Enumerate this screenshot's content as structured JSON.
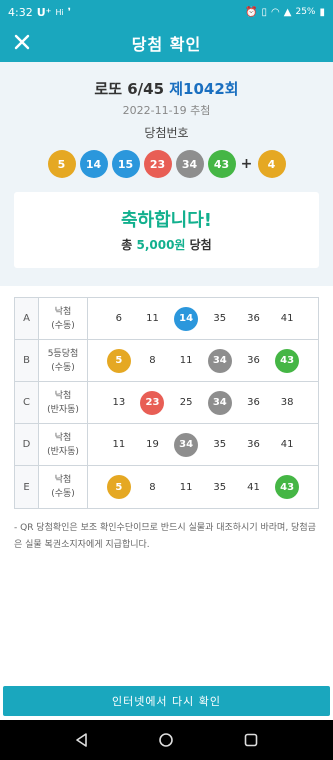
{
  "status_bar": {
    "time": "4:32",
    "carrier": "U⁺",
    "hd": "Hi",
    "battery": "25%"
  },
  "header": {
    "title": "당첨 확인"
  },
  "draw": {
    "game_name": "로또 6/45",
    "round": "제1042회",
    "date": "2022-11-19 추첨",
    "winning_label": "당첨번호",
    "winning_numbers": [
      {
        "n": "5",
        "color": "#e5a823"
      },
      {
        "n": "14",
        "color": "#2b97dc"
      },
      {
        "n": "15",
        "color": "#2b97dc"
      },
      {
        "n": "23",
        "color": "#e85e55"
      },
      {
        "n": "34",
        "color": "#8e8e8e"
      },
      {
        "n": "43",
        "color": "#45b645"
      }
    ],
    "plus": "+",
    "bonus": {
      "n": "4",
      "color": "#e5a823"
    }
  },
  "result": {
    "congrats": "축하합니다!",
    "prize_prefix": "총 ",
    "prize_amount": "5,000원",
    "prize_suffix": " 당첨"
  },
  "games": [
    {
      "label": "A",
      "res1": "낙첨",
      "res2": "(수동)",
      "numbers": [
        "6",
        "11",
        "14",
        "35",
        "36",
        "41"
      ],
      "matched": [
        false,
        false,
        true,
        false,
        false,
        false
      ],
      "match_colors": [
        "",
        "",
        "#2b97dc",
        "",
        "",
        ""
      ]
    },
    {
      "label": "B",
      "res1": "5등당첨",
      "res2": "(수동)",
      "numbers": [
        "5",
        "8",
        "11",
        "34",
        "36",
        "43"
      ],
      "matched": [
        true,
        false,
        false,
        true,
        false,
        true
      ],
      "match_colors": [
        "#e5a823",
        "",
        "",
        "#8e8e8e",
        "",
        "#45b645"
      ]
    },
    {
      "label": "C",
      "res1": "낙첨",
      "res2": "(반자동)",
      "numbers": [
        "13",
        "23",
        "25",
        "34",
        "36",
        "38"
      ],
      "matched": [
        false,
        true,
        false,
        true,
        false,
        false
      ],
      "match_colors": [
        "",
        "#e85e55",
        "",
        "#8e8e8e",
        "",
        ""
      ]
    },
    {
      "label": "D",
      "res1": "낙첨",
      "res2": "(반자동)",
      "numbers": [
        "11",
        "19",
        "34",
        "35",
        "36",
        "41"
      ],
      "matched": [
        false,
        false,
        true,
        false,
        false,
        false
      ],
      "match_colors": [
        "",
        "",
        "#8e8e8e",
        "",
        "",
        ""
      ]
    },
    {
      "label": "E",
      "res1": "낙첨",
      "res2": "(수동)",
      "numbers": [
        "5",
        "8",
        "11",
        "35",
        "41",
        "43"
      ],
      "matched": [
        true,
        false,
        false,
        false,
        false,
        true
      ],
      "match_colors": [
        "#e5a823",
        "",
        "",
        "",
        "",
        "#45b645"
      ]
    }
  ],
  "notice": "- QR 당첨확인은 보조 확인수단이므로 반드시 실물과 대조하시기 바라며, 당첨금은 실물 복권소지자에게 지급합니다.",
  "bottom_button": "인터넷에서 다시 확인",
  "icons": {
    "close": "close-icon",
    "back": "back-icon",
    "home": "home-icon",
    "recents": "recents-icon"
  },
  "colors": {
    "accent": "#1aa7be",
    "congrats": "#12b08e",
    "round": "#1a6fc0"
  }
}
